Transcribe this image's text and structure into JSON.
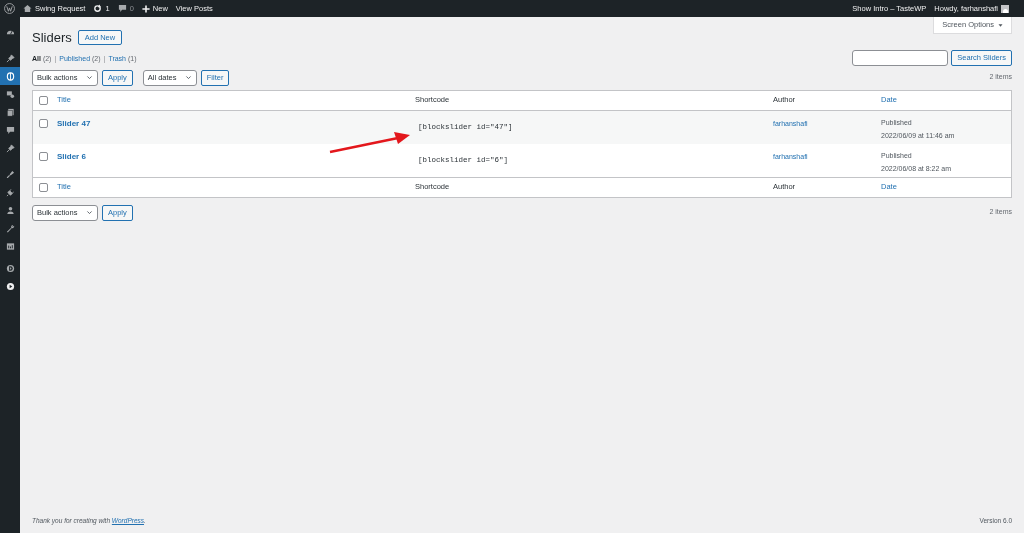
{
  "admin_bar": {
    "site": "Swing Request",
    "updates": "1",
    "comments": "0",
    "new": "New",
    "view": "View Posts",
    "intro": "Show Intro – TasteWP",
    "howdy": "Howdy, farhanshafi"
  },
  "sidebar": {
    "items": [
      {
        "selected": false
      },
      {
        "selected": false
      },
      {
        "selected": true
      },
      {
        "selected": false
      },
      {
        "selected": false
      },
      {
        "selected": false
      },
      {
        "selected": false
      },
      {
        "selected": false
      },
      {
        "selected": false
      },
      {
        "selected": false
      },
      {
        "selected": false
      },
      {
        "selected": false
      },
      {
        "selected": false
      },
      {
        "selected": false
      }
    ]
  },
  "screen_options": "Screen Options",
  "page_title": "Sliders",
  "add_new": "Add New",
  "views": [
    {
      "label": "All",
      "count": "(2)",
      "selected": true
    },
    {
      "separator": "|",
      "label": "Published",
      "count": "(2)",
      "selected": false
    },
    {
      "separator": "|",
      "label": "Trash",
      "count": "(1)",
      "selected": false
    }
  ],
  "search": {
    "button": "Search Sliders"
  },
  "top_nav": {
    "bulk": "Bulk actions",
    "apply": "Apply",
    "dates": "All dates",
    "filter": "Filter",
    "count": "2 items"
  },
  "table": {
    "select_all_checked": false,
    "footer_select_all_checked": false,
    "columns": [
      {
        "label": "Title",
        "sortable": true
      },
      {
        "label": "Shortcode",
        "sortable": false
      },
      {
        "label": "Author",
        "sortable": false
      },
      {
        "label": "Date",
        "sortable": true
      }
    ],
    "rows": [
      {
        "checked": false,
        "title": "Slider 47",
        "shortcode": "[blockslider id=\"47\"]",
        "author": "farhanshafi",
        "status": "Published",
        "date": "2022/06/09 at 11:46 am"
      },
      {
        "checked": false,
        "title": "Slider 6",
        "shortcode": "[blockslider id=\"6\"]",
        "author": "farhanshafi",
        "status": "Published",
        "date": "2022/06/08 at 8:22 am"
      }
    ],
    "footer_columns": [
      {
        "label": "Title",
        "sortable": true
      },
      {
        "label": "Shortcode",
        "sortable": false
      },
      {
        "label": "Author",
        "sortable": false
      },
      {
        "label": "Date",
        "sortable": true
      }
    ]
  },
  "bottom_nav": {
    "bulk": "Bulk actions",
    "apply": "Apply",
    "count": "2 items"
  },
  "footer": {
    "thanks": "Thank you for creating with",
    "link": "WordPress",
    "after": ".",
    "version": "Version 6.0"
  }
}
